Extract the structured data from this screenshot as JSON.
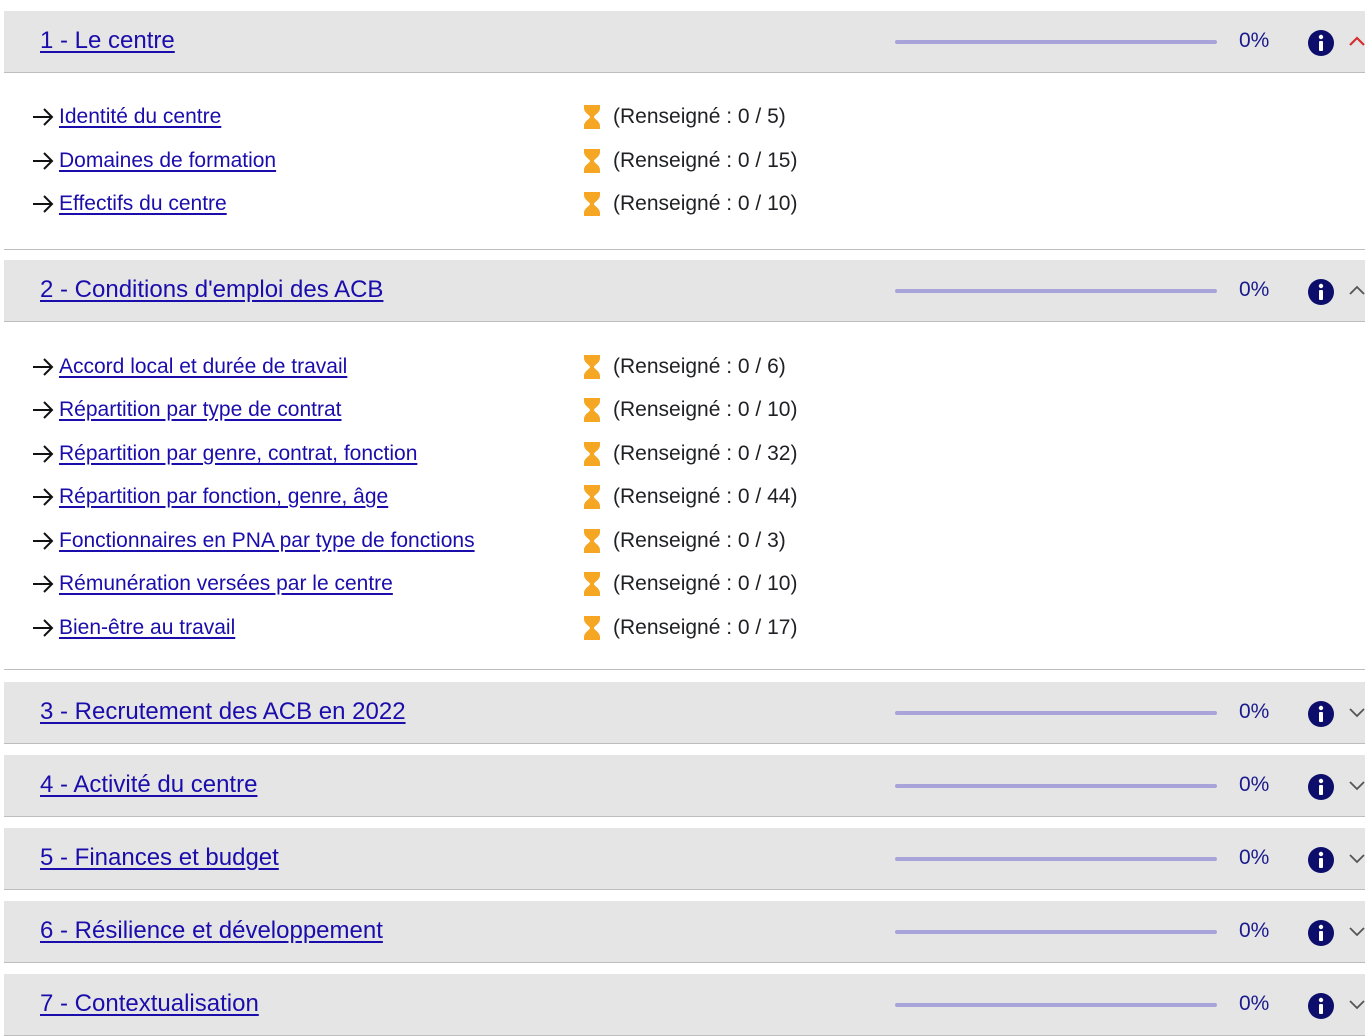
{
  "colors": {
    "header_bg": "#e5e5e5",
    "link": "#1a0dab",
    "progress_track": "#a8a3d8",
    "info_icon": "#0d0d6b",
    "hourglass": "#f5a623",
    "collapse_accent": "#d32f2f"
  },
  "sections": [
    {
      "title": "1 - Le centre",
      "progress": 0,
      "percent_label": "0%",
      "expanded": true,
      "toggle_icon": "chevron-up-icon",
      "items": [
        {
          "label": "Identité du centre",
          "status": "(Renseigné : 0 / 5)"
        },
        {
          "label": "Domaines de formation",
          "status": "(Renseigné : 0 / 15)"
        },
        {
          "label": "Effectifs du centre",
          "status": "(Renseigné : 0 / 10)"
        }
      ]
    },
    {
      "title": "2 - Conditions d'emploi des ACB",
      "progress": 0,
      "percent_label": "0%",
      "expanded": true,
      "toggle_icon": "chevron-up-icon",
      "items": [
        {
          "label": "Accord local et durée de travail",
          "status": "(Renseigné : 0 / 6)"
        },
        {
          "label": "Répartition par type de contrat",
          "status": "(Renseigné : 0 / 10)"
        },
        {
          "label": "Répartition par genre, contrat, fonction",
          "status": "(Renseigné : 0 / 32)"
        },
        {
          "label": "Répartition par fonction, genre, âge",
          "status": "(Renseigné : 0 / 44)"
        },
        {
          "label": "Fonctionnaires en PNA par type de fonctions",
          "status": "(Renseigné : 0 / 3)"
        },
        {
          "label": "Rémunération versées par le centre",
          "status": "(Renseigné : 0 / 10)"
        },
        {
          "label": "Bien-être au travail",
          "status": "(Renseigné : 0 / 17)"
        }
      ]
    },
    {
      "title": "3 - Recrutement des ACB en 2022",
      "progress": 0,
      "percent_label": "0%",
      "expanded": false,
      "toggle_icon": "chevron-down-icon"
    },
    {
      "title": "4 - Activité du centre",
      "progress": 0,
      "percent_label": "0%",
      "expanded": false,
      "toggle_icon": "chevron-down-icon"
    },
    {
      "title": "5 - Finances et budget",
      "progress": 0,
      "percent_label": "0%",
      "expanded": false,
      "toggle_icon": "chevron-down-icon"
    },
    {
      "title": "6 - Résilience et développement",
      "progress": 0,
      "percent_label": "0%",
      "expanded": false,
      "toggle_icon": "chevron-down-icon"
    },
    {
      "title": "7 - Contextualisation",
      "progress": 0,
      "percent_label": "0%",
      "expanded": false,
      "toggle_icon": "chevron-down-icon"
    }
  ]
}
